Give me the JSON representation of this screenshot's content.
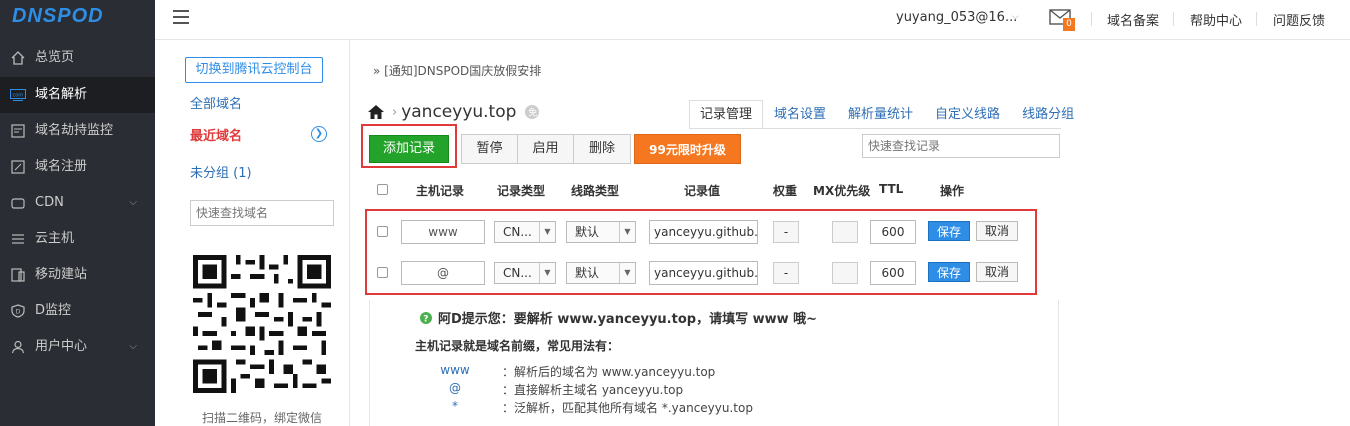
{
  "brand": "DNSPOD",
  "sidebar": {
    "items": [
      {
        "label": "总览页",
        "icon": "home-icon"
      },
      {
        "label": "域名解析",
        "icon": "dns-icon",
        "active": true
      },
      {
        "label": "域名劫持监控",
        "icon": "monitor-icon"
      },
      {
        "label": "域名注册",
        "icon": "register-icon"
      },
      {
        "label": "CDN",
        "icon": "cloud-icon",
        "expandable": true
      },
      {
        "label": "云主机",
        "icon": "server-icon"
      },
      {
        "label": "移动建站",
        "icon": "mobile-icon"
      },
      {
        "label": "D监控",
        "icon": "shield-icon"
      },
      {
        "label": "用户中心",
        "icon": "user-icon",
        "expandable": true
      }
    ]
  },
  "topbar": {
    "user": "yuyang_053@16...",
    "mail_count": "0",
    "links": [
      "域名备案",
      "帮助中心",
      "问题反馈"
    ]
  },
  "leftpanel": {
    "switch_btn": "切换到腾讯云控制台",
    "all_domains": "全部域名",
    "recent_domains": "最近域名",
    "ungrouped": "未分组 (1)",
    "search_placeholder": "快速查找域名",
    "qr_caption": "扫描二维码，绑定微信"
  },
  "main": {
    "notice": "» [通知]DNSPOD国庆放假安排",
    "domain": "yanceyyu.top",
    "tabs": [
      "记录管理",
      "域名设置",
      "解析量统计",
      "自定义线路",
      "线路分组"
    ],
    "buttons": {
      "add": "添加记录",
      "pause": "暂停",
      "enable": "启用",
      "delete": "删除",
      "upgrade": "99元限时升级"
    },
    "record_search_placeholder": "快速查找记录",
    "columns": [
      "主机记录",
      "记录类型",
      "线路类型",
      "记录值",
      "权重",
      "MX优先级",
      "TTL",
      "操作"
    ],
    "records": [
      {
        "host": "www",
        "type": "CN...",
        "line": "默认",
        "value": "yanceyyu.github.io",
        "weight": "-",
        "ttl": "600",
        "save": "保存",
        "cancel": "取消"
      },
      {
        "host": "@",
        "type": "CN...",
        "line": "默认",
        "value": "yanceyyu.github.io",
        "weight": "-",
        "ttl": "600",
        "save": "保存",
        "cancel": "取消"
      }
    ],
    "tips": {
      "title": "阿D提示您：要解析 www.yanceyyu.top，请填写 www 哦~",
      "subtitle": "主机记录就是域名前缀，常见用法有：",
      "items": [
        {
          "key": "www",
          "desc": "：解析后的域名为 www.yanceyyu.top"
        },
        {
          "key": "@",
          "desc": "：直接解析主域名 yanceyyu.top"
        },
        {
          "key": "*",
          "desc": "：泛解析，匹配其他所有域名 *.yanceyyu.top"
        }
      ]
    }
  },
  "colors": {
    "sidebar_bg": "#2a2d33",
    "brand_blue": "#2e8ee6",
    "add_green": "#23a32a",
    "upgrade_orange": "#f5771f",
    "highlight_red": "#e03a3a",
    "recent_red": "#e03a3a"
  }
}
